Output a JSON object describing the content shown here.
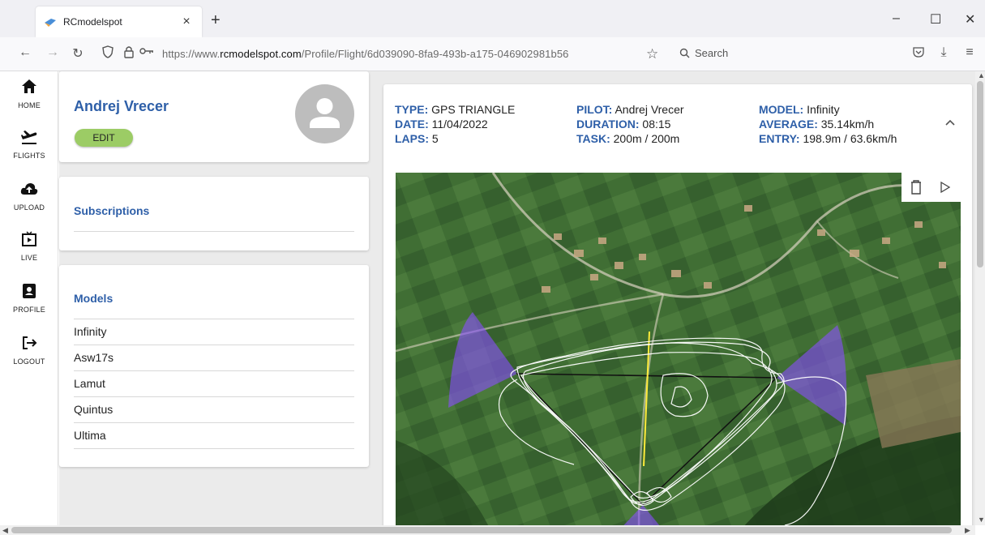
{
  "browser": {
    "tab_title": "RCmodelspot",
    "tab_close": "×",
    "new_tab": "+",
    "url_prefix": "https://www.",
    "url_domain": "rcmodelspot.com",
    "url_path": "/Profile/Flight/6d039090-8fa9-493b-a175-046902981b56",
    "search_placeholder": "Search",
    "minimize": "–",
    "maximize": "☐",
    "close": "✕"
  },
  "rail": {
    "items": [
      {
        "label": "HOME",
        "icon": "home-icon"
      },
      {
        "label": "FLIGHTS",
        "icon": "flight-takeoff-icon"
      },
      {
        "label": "UPLOAD",
        "icon": "cloud-upload-icon"
      },
      {
        "label": "LIVE",
        "icon": "live-tv-icon"
      },
      {
        "label": "PROFILE",
        "icon": "profile-badge-icon"
      },
      {
        "label": "LOGOUT",
        "icon": "logout-icon"
      }
    ]
  },
  "profile": {
    "name": "Andrej Vrecer",
    "edit_label": "EDIT",
    "edit_color": "#9ccc65"
  },
  "subscriptions": {
    "title": "Subscriptions"
  },
  "models": {
    "title": "Models",
    "items": [
      "Infinity",
      "Asw17s",
      "Lamut",
      "Quintus",
      "Ultima"
    ]
  },
  "flight": {
    "type_key": "TYPE:",
    "type_val": "GPS TRIANGLE",
    "date_key": "DATE:",
    "date_val": "11/04/2022",
    "laps_key": "LAPS:",
    "laps_val": "5",
    "pilot_key": "PILOT:",
    "pilot_val": "Andrej Vrecer",
    "duration_key": "DURATION:",
    "duration_val": "08:15",
    "task_key": "TASK:",
    "task_val": "200m / 200m",
    "model_key": "MODEL:",
    "model_val": "Infinity",
    "average_key": "AVERAGE:",
    "average_val": "35.14km/h",
    "entry_key": "ENTRY:",
    "entry_val": "198.9m / 63.6km/h"
  },
  "colors": {
    "accent": "#2e5fa8",
    "sector": "#8a4dff",
    "triangle": "#111111",
    "startline": "#ffeb3b",
    "track": "#ffffff"
  }
}
